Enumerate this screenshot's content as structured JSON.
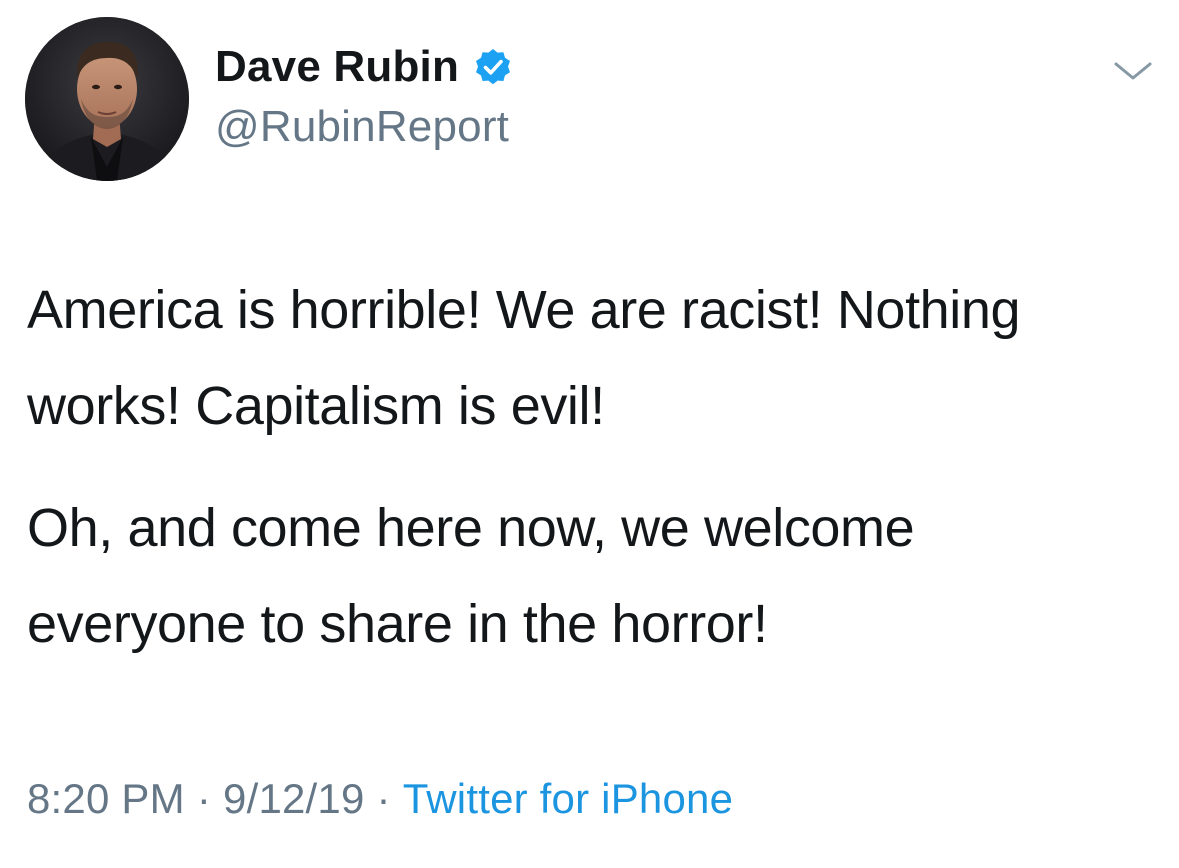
{
  "author": {
    "display_name": "Dave Rubin",
    "handle": "@RubinReport",
    "verified_icon": "verified-badge-icon",
    "avatar": "profile-photo"
  },
  "tweet": {
    "paragraphs": [
      "America is horrible! We are racist! Nothing works! Capitalism is evil!",
      "Oh, and come here now, we welcome everyone to share in the horror!"
    ]
  },
  "meta": {
    "time": "8:20 PM",
    "separator": "·",
    "date": "9/12/19",
    "source": "Twitter for iPhone"
  },
  "menu": {
    "icon": "chevron-down-icon"
  },
  "colors": {
    "text": "#14171a",
    "secondary": "#657786",
    "link": "#1b95e0",
    "verified": "#1da1f2"
  }
}
